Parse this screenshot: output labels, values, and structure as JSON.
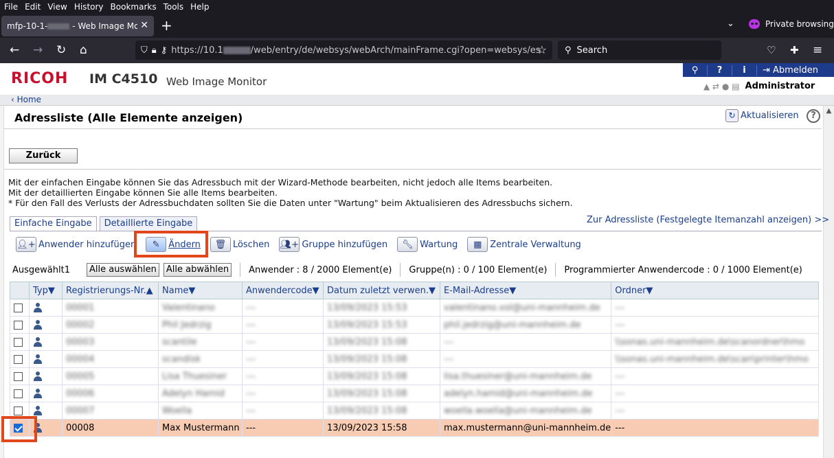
{
  "browser": {
    "menu": [
      "File",
      "Edit",
      "View",
      "History",
      "Bookmarks",
      "Tools",
      "Help"
    ],
    "tab_title_prefix": "mfp-10-1-",
    "tab_title_suffix": " - Web Image Monit",
    "url_prefix": "https://10.1",
    "url_suffix": "/web/entry/de/websys/webArch/mainFrame.cgi?open=websys/es",
    "search_placeholder": "Search",
    "private_label": "Private browsing"
  },
  "header": {
    "brand": "RICOH",
    "model": "IM C4510",
    "product": "Web Image Monitor",
    "logout": "Abmelden",
    "user": "Administrator",
    "home": "Home"
  },
  "page": {
    "title": "Adressliste (Alle Elemente anzeigen)",
    "refresh": "Aktualisieren",
    "back": "Zurück",
    "info": [
      "Mit der einfachen Eingabe können Sie das Adressbuch mit der Wizard-Methode bearbeiten, nicht jedoch alle Items bearbeiten.",
      "Mit der detaillierten Eingabe können Sie alle Items bearbeiten.",
      "* Für den Fall des Verlusts der Adressbuchdaten sollten Sie die Daten unter \"Wartung\" beim Aktualisieren des Adressbuchs sichern."
    ],
    "tabs": [
      "Einfache Eingabe",
      "Detaillierte Eingabe"
    ],
    "list_link": "Zur Adressliste (Festgelegte Itemanzahl anzeigen) >>",
    "tools": [
      "Anwender hinzufügen",
      "Ändern",
      "Löschen",
      "Gruppe hinzufügen",
      "Wartung",
      "Zentrale Verwaltung"
    ],
    "selected": "Ausgewählt1",
    "select_all": "Alle auswählen",
    "deselect_all": "Alle abwählen",
    "users_count": "Anwender : 8 / 2000 Element(e)",
    "groups_count": "Gruppe(n) : 0 / 100 Element(e)",
    "prog_count": "Programmierter Anwendercode : 0 / 1000 Element(e)"
  },
  "table": {
    "headers": [
      "Typ▼",
      "Registrierungs-Nr.▲",
      "Name▼",
      "Anwendercode▼",
      "Datum zuletzt verwen.▼",
      "E-Mail-Adresse▼",
      "Ordner▼"
    ],
    "rows": [
      {
        "checked": false,
        "blur": true,
        "nr": "00001",
        "name": "Valentinano",
        "code": "---",
        "date": "13/09/2023 15:53",
        "email": "valentinano.vol@uni-mannheim.de",
        "folder": "---"
      },
      {
        "checked": false,
        "blur": true,
        "nr": "00002",
        "name": "Phil Jedrzig",
        "code": "---",
        "date": "13/09/2023 15:53",
        "email": "phil.jedrzig@uni-mannheim.de",
        "folder": "---"
      },
      {
        "checked": false,
        "blur": true,
        "nr": "00003",
        "name": "scantile",
        "code": "---",
        "date": "13/09/2023 15:08",
        "email": "---",
        "folder": "\\\\sonas.uni-mannheim.de\\scanordner\\hmo"
      },
      {
        "checked": false,
        "blur": true,
        "nr": "00004",
        "name": "scandisk",
        "code": "---",
        "date": "13/09/2023 15:08",
        "email": "---",
        "folder": "\\\\sonas.uni-mannheim.de\\scan\\printer\\hmo"
      },
      {
        "checked": false,
        "blur": true,
        "nr": "00005",
        "name": "Lisa Thuesiner",
        "code": "---",
        "date": "13/09/2023 15:08",
        "email": "lisa.thuesiner@uni-mannheim.de",
        "folder": "---"
      },
      {
        "checked": false,
        "blur": true,
        "nr": "00006",
        "name": "Adelyn Hamid",
        "code": "---",
        "date": "13/09/2023 15:08",
        "email": "adelyn.hamid@uni-mannheim.de",
        "folder": "---"
      },
      {
        "checked": false,
        "blur": true,
        "nr": "00007",
        "name": "Woella",
        "code": "---",
        "date": "13/09/2023 15:08",
        "email": "woella.woella@uni-mannheim.de",
        "folder": "---"
      },
      {
        "checked": true,
        "blur": false,
        "nr": "00008",
        "name": "Max Mustermann",
        "code": "---",
        "date": "13/09/2023 15:58",
        "email": "max.mustermann@uni-mannheim.de",
        "folder": "---"
      }
    ]
  },
  "colors": {
    "accent_red": "#e2471c",
    "ricoh_red": "#c8102e",
    "selected_row": "#f7ccb2",
    "link": "#1a3e8c"
  }
}
